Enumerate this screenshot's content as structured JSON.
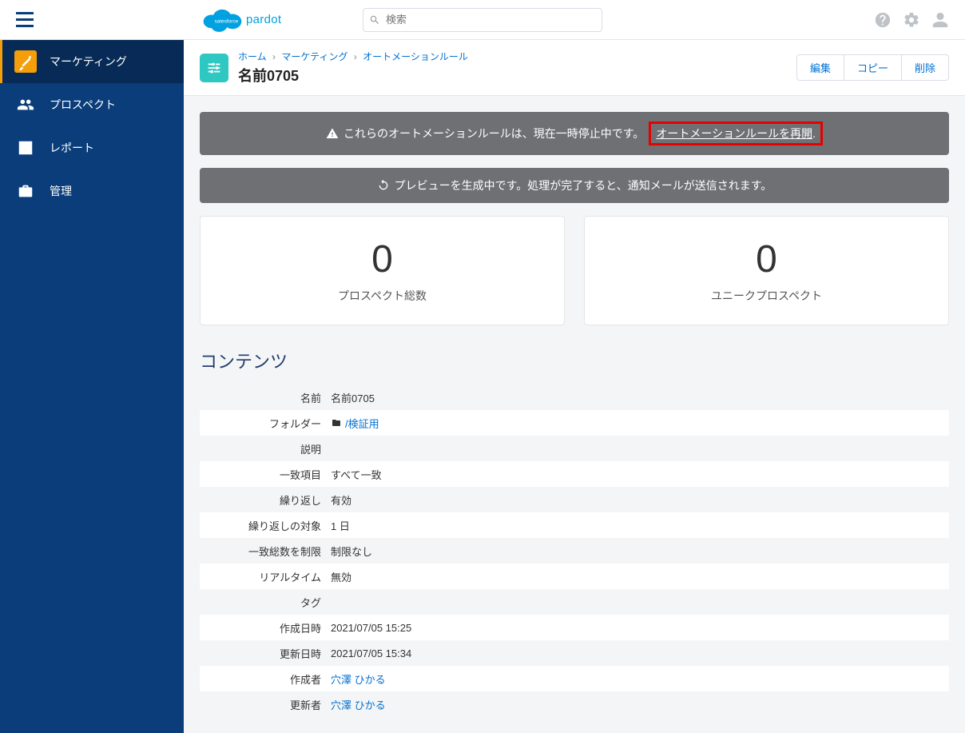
{
  "search": {
    "placeholder": "検索"
  },
  "sidebar": {
    "items": [
      {
        "label": "マーケティング"
      },
      {
        "label": "プロスペクト"
      },
      {
        "label": "レポート"
      },
      {
        "label": "管理"
      }
    ]
  },
  "breadcrumbs": {
    "home": "ホーム",
    "marketing": "マーケティング",
    "automation": "オートメーションルール"
  },
  "page_title": "名前0705",
  "actions": {
    "edit": "編集",
    "copy": "コピー",
    "delete": "削除"
  },
  "banner_paused": {
    "text": "これらのオートメーションルールは、現在一時停止中です。",
    "link": "オートメーションルールを再開",
    "period": "."
  },
  "banner_preview": {
    "text": "プレビューを生成中です。処理が完了すると、通知メールが送信されます。"
  },
  "stats": [
    {
      "value": "0",
      "label": "プロスペクト総数"
    },
    {
      "value": "0",
      "label": "ユニークプロスペクト"
    }
  ],
  "content_heading": "コンテンツ",
  "details": {
    "rows": [
      {
        "label": "名前",
        "value": "名前0705"
      },
      {
        "label": "フォルダー",
        "value": "/検証用",
        "is_folder_link": true
      },
      {
        "label": "説明",
        "value": ""
      },
      {
        "label": "一致項目",
        "value": "すべて一致"
      },
      {
        "label": "繰り返し",
        "value": "有効"
      },
      {
        "label": "繰り返しの対象",
        "value": "1 日"
      },
      {
        "label": "一致総数を制限",
        "value": "制限なし"
      },
      {
        "label": "リアルタイム",
        "value": "無効"
      },
      {
        "label": "タグ",
        "value": ""
      },
      {
        "label": "作成日時",
        "value": "2021/07/05 15:25"
      },
      {
        "label": "更新日時",
        "value": "2021/07/05 15:34"
      },
      {
        "label": "作成者",
        "value": "穴澤 ひかる",
        "is_link": true
      },
      {
        "label": "更新者",
        "value": "穴澤 ひかる",
        "is_link": true
      }
    ]
  }
}
